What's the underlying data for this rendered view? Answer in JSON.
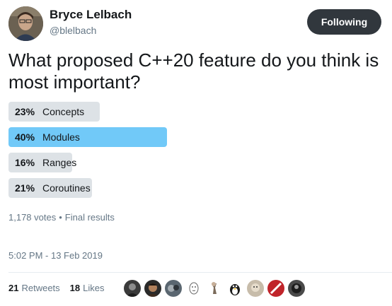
{
  "author": {
    "name": "Bryce Lelbach",
    "handle": "@blelbach",
    "follow_label": "Following"
  },
  "question": "What proposed C++20 feature do you think is most important?",
  "poll": {
    "choices": [
      {
        "percent": "23%",
        "label": "Concepts",
        "value": 23
      },
      {
        "percent": "40%",
        "label": "Modules",
        "value": 40
      },
      {
        "percent": "16%",
        "label": "Ranges",
        "value": 16
      },
      {
        "percent": "21%",
        "label": "Coroutines",
        "value": 21
      }
    ],
    "votes": "1,178 votes",
    "status": "Final results"
  },
  "timestamp": "5:02 PM - 13 Feb 2019",
  "stats": {
    "retweets_count": "21",
    "retweets_label": "Retweets",
    "likes_count": "18",
    "likes_label": "Likes"
  },
  "colors": {
    "follow_button": "#31373d",
    "winner_bar": "#71c9f8",
    "bar": "#dde2e6",
    "secondary_text": "#657786"
  }
}
